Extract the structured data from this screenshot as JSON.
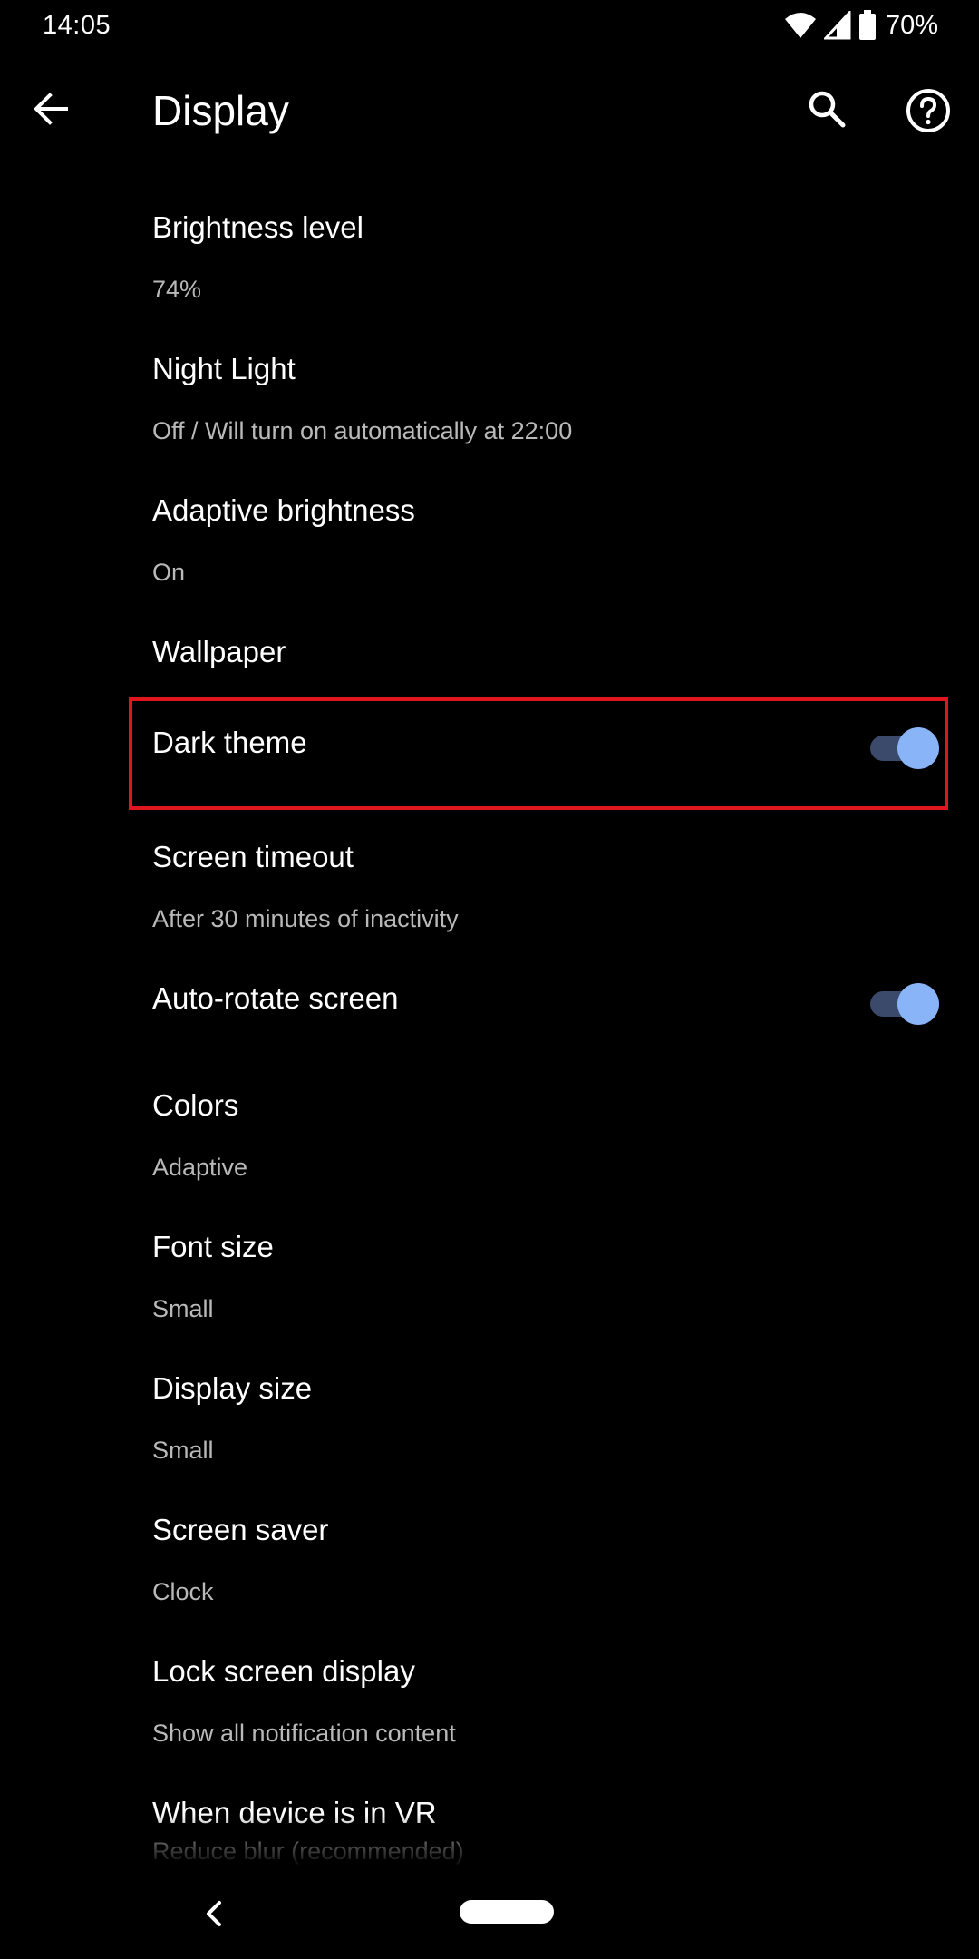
{
  "status_bar": {
    "time": "14:05",
    "battery_percent": "70%",
    "icons": [
      "wifi-icon",
      "cell-signal-icon",
      "battery-icon"
    ]
  },
  "toolbar": {
    "title": "Display",
    "back_icon": "back-arrow-icon",
    "search_icon": "search-icon",
    "help_icon": "help-icon"
  },
  "settings": {
    "items": [
      {
        "title": "Brightness level",
        "summary": "74%"
      },
      {
        "title": "Night Light",
        "summary": "Off / Will turn on automatically at 22:00"
      },
      {
        "title": "Adaptive brightness",
        "summary": "On"
      },
      {
        "title": "Wallpaper"
      },
      {
        "title": "Dark theme",
        "toggle": true,
        "highlighted": true
      },
      {
        "title": "Screen timeout",
        "summary": "After 30 minutes of inactivity"
      },
      {
        "title": "Auto-rotate screen",
        "toggle": true
      },
      {
        "title": "Colors",
        "summary": "Adaptive"
      },
      {
        "title": "Font size",
        "summary": "Small"
      },
      {
        "title": "Display size",
        "summary": "Small"
      },
      {
        "title": "Screen saver",
        "summary": "Clock"
      },
      {
        "title": "Lock screen display",
        "summary": "Show all notification content"
      },
      {
        "title": "When device is in VR",
        "summary": "Reduce blur (recommended)"
      }
    ]
  },
  "nav_bar": {
    "back_icon": "nav-back-icon",
    "home_icon": "home-pill-icon"
  },
  "colors": {
    "background": "#000000",
    "accent": "#8ab4f8",
    "toggle_track": "#3b4a6b",
    "highlight": "#e0161e",
    "summary_text": "#b9b9b9"
  }
}
